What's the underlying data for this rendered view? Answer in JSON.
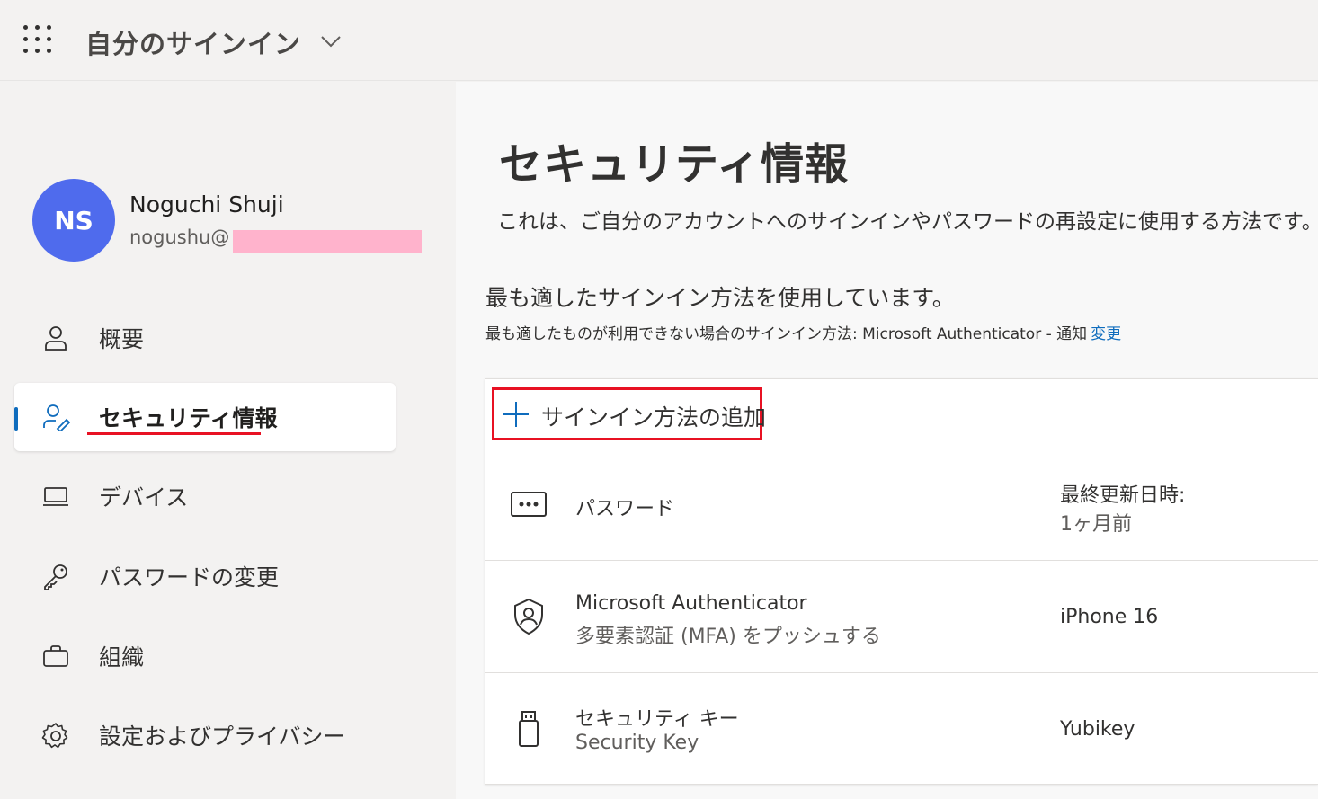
{
  "header": {
    "app_title": "自分のサインイン"
  },
  "user": {
    "initials": "NS",
    "name": "Noguchi Shuji",
    "email_prefix": "nogushu@",
    "avatar_color": "#4f6bed"
  },
  "sidebar": {
    "items": [
      {
        "label": "概要",
        "icon": "person-icon"
      },
      {
        "label": "セキュリティ情報",
        "icon": "person-key-icon",
        "active": true
      },
      {
        "label": "デバイス",
        "icon": "laptop-icon"
      },
      {
        "label": "パスワードの変更",
        "icon": "key-icon"
      },
      {
        "label": "組織",
        "icon": "briefcase-icon"
      },
      {
        "label": "設定およびプライバシー",
        "icon": "gear-icon"
      }
    ]
  },
  "main": {
    "title": "セキュリティ情報",
    "description": "これは、ご自分のアカウントへのサインインやパスワードの再設定に使用する方法です。",
    "best_method": "最も適したサインイン方法を使用しています。",
    "fallback_text": "最も適したものが利用できない場合のサインイン方法: Microsoft Authenticator - 通知",
    "fallback_link": "変更",
    "add_method_label": "サインイン方法の追加",
    "methods": [
      {
        "icon": "password-icon",
        "title": "パスワード",
        "subtitle": "",
        "value_label": "最終更新日時:",
        "value": "1ヶ月前"
      },
      {
        "icon": "authenticator-icon",
        "title": "Microsoft Authenticator",
        "subtitle": "多要素認証 (MFA) をプッシュする",
        "value_label": "",
        "value": "iPhone 16"
      },
      {
        "icon": "usb-key-icon",
        "title": "セキュリティ キー",
        "subtitle": "Security Key",
        "value_label": "",
        "value": "Yubikey"
      }
    ]
  },
  "colors": {
    "accent": "#0f6cbd",
    "highlight_red": "#e81123",
    "redaction": "#ffb3cc"
  }
}
